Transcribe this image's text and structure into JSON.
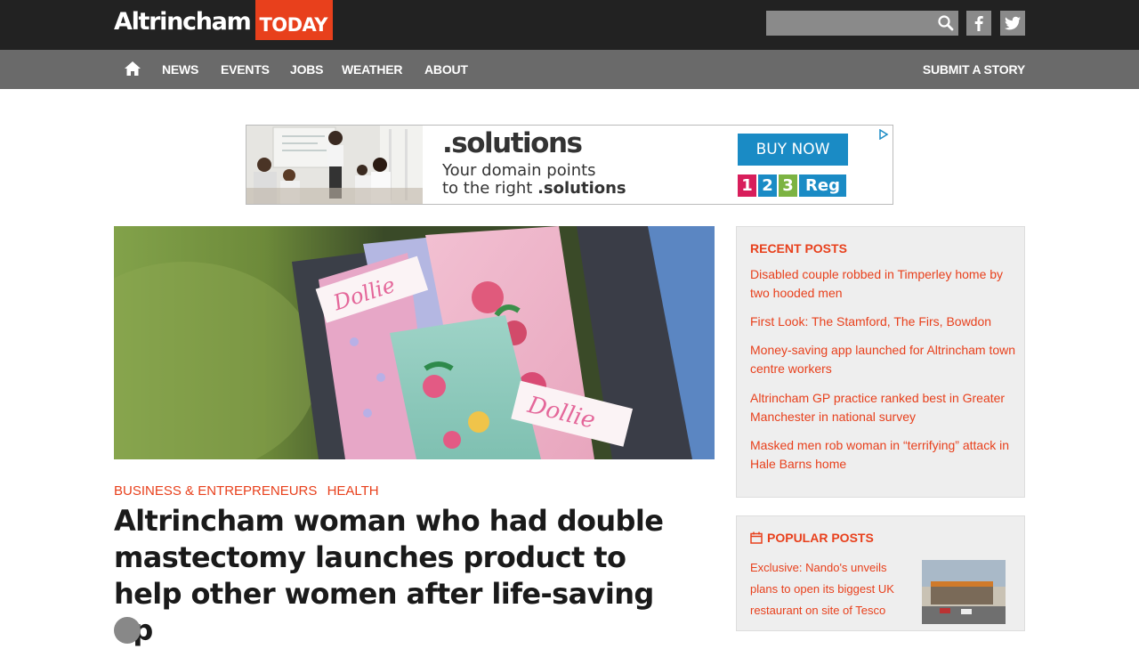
{
  "site": {
    "logo_main": "Altrincham",
    "logo_accent": "TODAY"
  },
  "header": {
    "search_placeholder": "",
    "icons": [
      "search-icon",
      "facebook-icon",
      "twitter-icon"
    ]
  },
  "nav": {
    "home_icon": "home-icon",
    "items": [
      "NEWS",
      "EVENTS",
      "JOBS",
      "WEATHER",
      "ABOUT"
    ],
    "submit": "SUBMIT A STORY"
  },
  "ad": {
    "headline": ".solutions",
    "line1": "Your domain points",
    "line2_prefix": "to the right ",
    "line2_bold": ".solutions",
    "cta": "BUY NOW",
    "brand_1": "1",
    "brand_2": "2",
    "brand_3": "3",
    "brand_reg": "Reg"
  },
  "article": {
    "categories": [
      "BUSINESS & ENTREPRENEURS",
      "HEALTH"
    ],
    "title": "Altrincham woman who had double mastectomy launches product to help other women after life-saving op",
    "image_label_1": "Dollie",
    "image_label_2": "Dollie"
  },
  "sidebar": {
    "recent_title": "RECENT POSTS",
    "recent": [
      "Disabled couple robbed in Timperley home by two hooded men",
      "First Look: The Stamford, The Firs, Bowdon",
      "Money-saving app launched for Altrincham town centre workers",
      "Altrincham GP practice ranked best in Greater Manchester in national survey",
      "Masked men rob woman in “terrifying” attack in Hale Barns home"
    ],
    "popular_title": "POPULAR POSTS",
    "popular": [
      "Exclusive: Nando's unveils plans to open its biggest UK restaurant on site of Tesco"
    ]
  },
  "colors": {
    "accent": "#e8401c",
    "topbar": "#222222",
    "navbar": "#6a6a6a",
    "sidebar_bg": "#eeeeee",
    "ad_blue": "#1a8bc5"
  }
}
